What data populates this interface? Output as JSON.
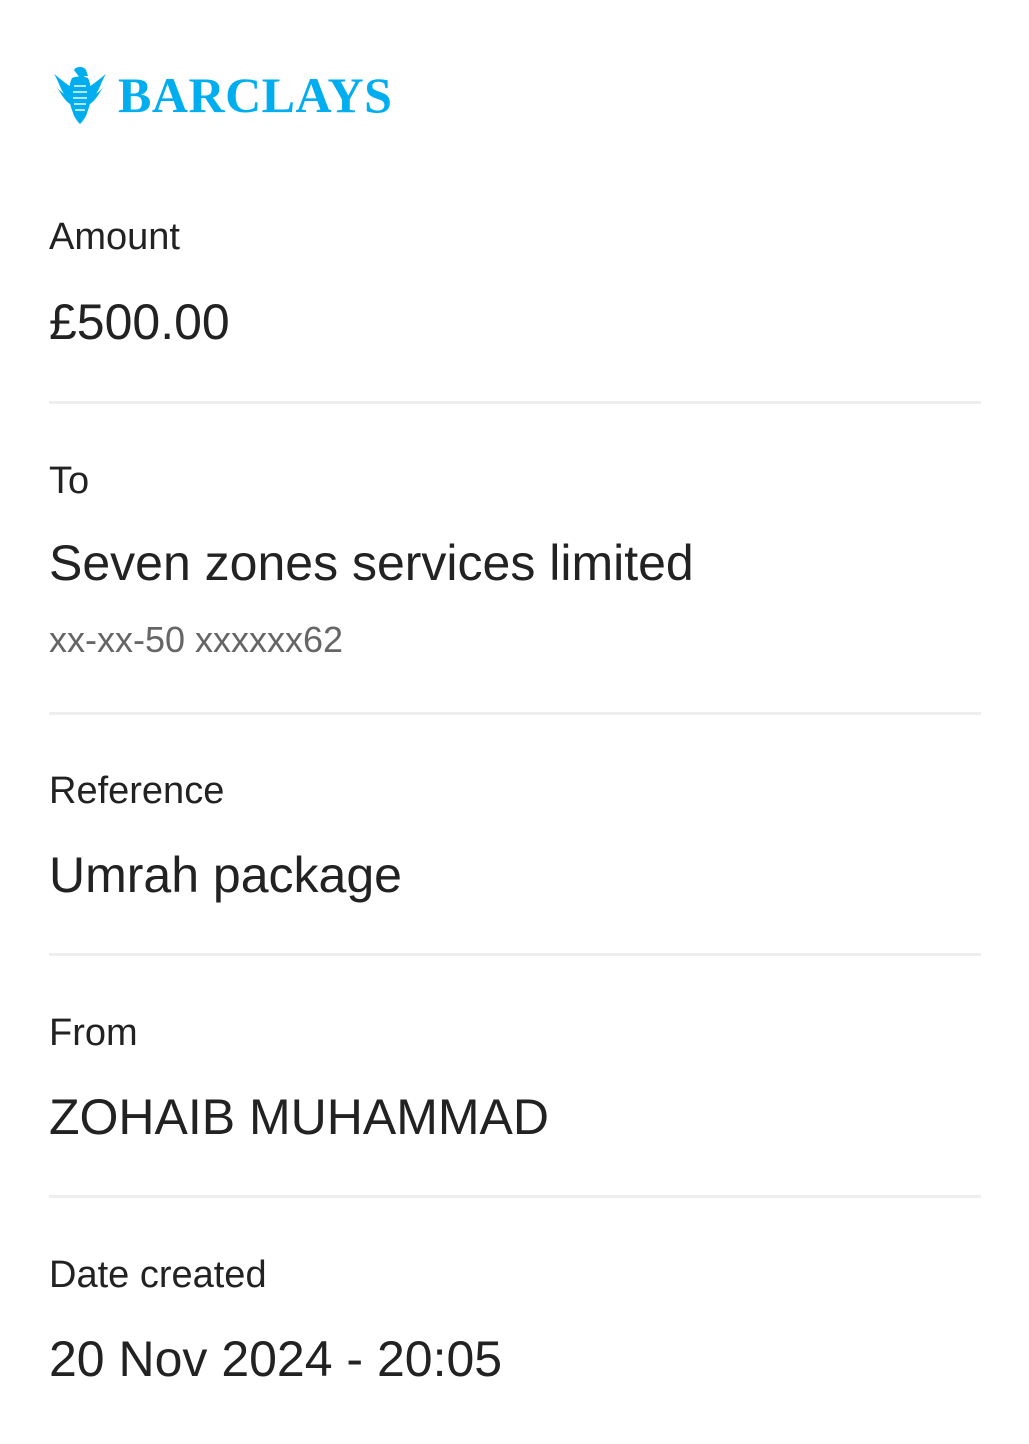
{
  "brand": {
    "name": "BARCLAYS",
    "color": "#00aeef",
    "icon": "eagle-icon"
  },
  "amount": {
    "label": "Amount",
    "value": "£500.00"
  },
  "to": {
    "label": "To",
    "name": "Seven zones services limited",
    "account": "xx-xx-50 xxxxxx62"
  },
  "reference": {
    "label": "Reference",
    "value": "Umrah package"
  },
  "from": {
    "label": "From",
    "value": "ZOHAIB MUHAMMAD"
  },
  "date_created": {
    "label": "Date created",
    "value": "20 Nov 2024 - 20:05"
  }
}
